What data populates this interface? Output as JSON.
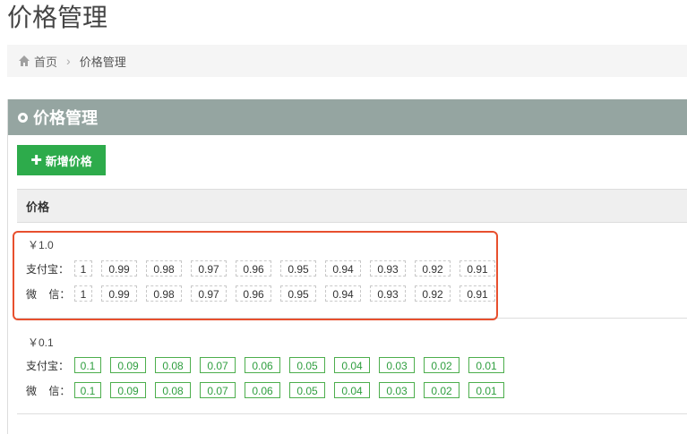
{
  "page": {
    "title": "价格管理"
  },
  "breadcrumb": {
    "home": "首页",
    "current": "价格管理"
  },
  "panel": {
    "title": "价格管理",
    "add_button": "新增价格"
  },
  "table": {
    "header": "价格",
    "groups": [
      {
        "price": "￥1.0",
        "alipay_label": "支付宝：",
        "wechat_label": "微    信：",
        "alipay": [
          "1",
          "0.99",
          "0.98",
          "0.97",
          "0.96",
          "0.95",
          "0.94",
          "0.93",
          "0.92",
          "0.91"
        ],
        "wechat": [
          "1",
          "0.99",
          "0.98",
          "0.97",
          "0.96",
          "0.95",
          "0.94",
          "0.93",
          "0.92",
          "0.91"
        ]
      },
      {
        "price": "￥0.1",
        "alipay_label": "支付宝：",
        "wechat_label": "微    信：",
        "alipay": [
          "0.1",
          "0.09",
          "0.08",
          "0.07",
          "0.06",
          "0.05",
          "0.04",
          "0.03",
          "0.02",
          "0.01"
        ],
        "wechat": [
          "0.1",
          "0.09",
          "0.08",
          "0.07",
          "0.06",
          "0.05",
          "0.04",
          "0.03",
          "0.02",
          "0.01"
        ]
      }
    ]
  },
  "colors": {
    "header_bg": "#95a5a1",
    "button": "#2dab4b",
    "highlight": "#e8502e",
    "green_text": "#2f9e3f"
  }
}
